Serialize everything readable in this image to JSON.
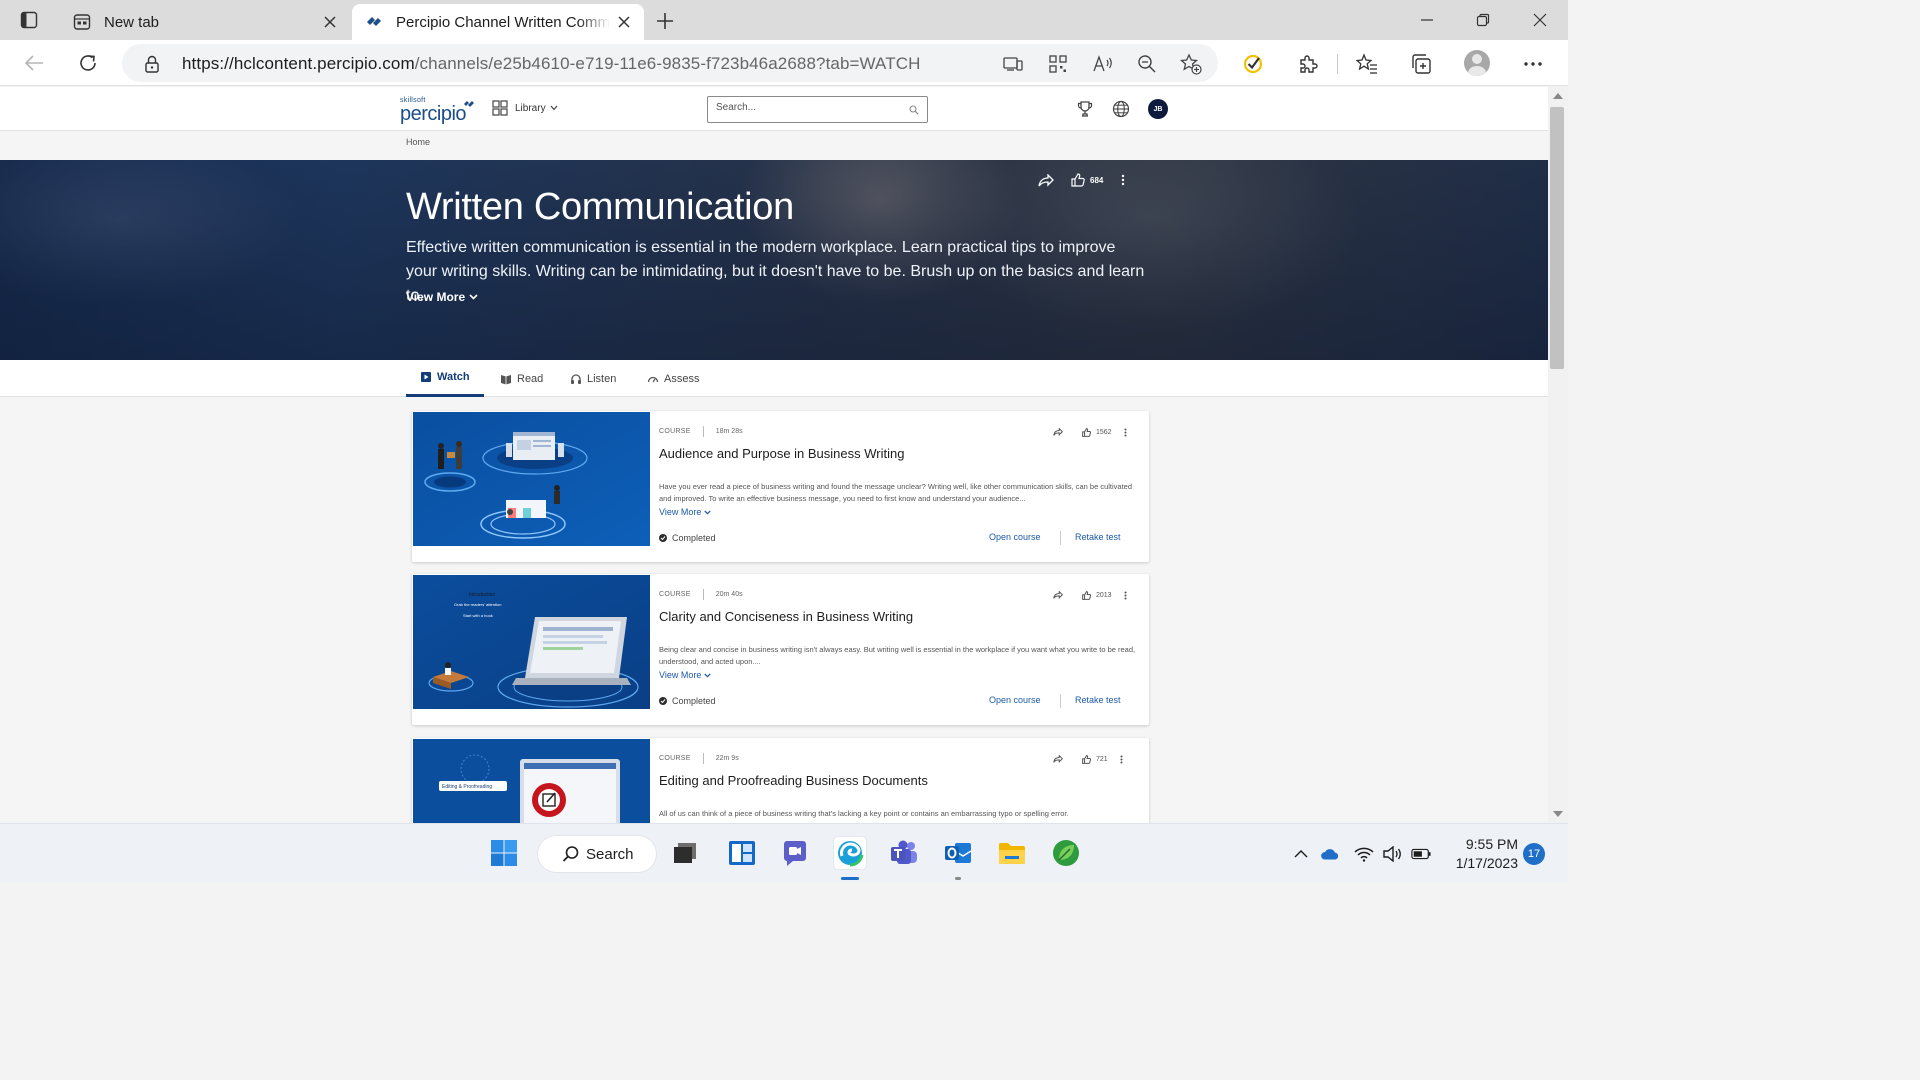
{
  "browser": {
    "tabs": [
      {
        "title": "New tab",
        "active": false
      },
      {
        "title": "Percipio Channel Written Communication",
        "active": true
      }
    ],
    "url_host": "https://hclcontent.percipio.com",
    "url_path": "/channels/e25b4610-e719-11e6-9835-f723b46a2688?tab=WATCH"
  },
  "site": {
    "logo_small": "skillsoft",
    "logo_big": "percipio",
    "library_label": "Library",
    "search_placeholder": "Search...",
    "avatar_initials": "JB",
    "breadcrumb": "Home"
  },
  "hero": {
    "title": "Written Communication",
    "description": "Effective written communication is essential in the modern workplace. Learn practical tips to improve your writing skills. Writing can be intimidating, but it doesn't have to be. Brush up on the basics and learn to...",
    "view_more": "View More",
    "likes": "684"
  },
  "content_tabs": [
    "Watch",
    "Read",
    "Listen",
    "Assess"
  ],
  "cards": [
    {
      "type": "COURSE",
      "duration": "18m 28s",
      "likes": "1562",
      "title": "Audience and Purpose in Business Writing",
      "description": "Have you ever read a piece of business writing and found the message unclear? Writing well, like other communication skills, can be cultivated and improved. To write an effective business message, you need to first know and understand your audience...",
      "view_more": "View More",
      "status": "Completed",
      "open_label": "Open course",
      "retake_label": "Retake test"
    },
    {
      "type": "COURSE",
      "duration": "20m 40s",
      "likes": "2013",
      "title": "Clarity and Conciseness in Business Writing",
      "description": "Being clear and concise in business writing isn't always easy. But writing well is essential in the workplace if you want what you write to be read, understood, and acted upon....",
      "view_more": "View More",
      "status": "Completed",
      "open_label": "Open course",
      "retake_label": "Retake test",
      "thumb_labels": [
        "Introduction",
        "Grab the readers' attention",
        "Start with a hook"
      ]
    },
    {
      "type": "COURSE",
      "duration": "22m 9s",
      "likes": "721",
      "title": "Editing and Proofreading Business Documents",
      "description": "All of us can think of a piece of business writing that's lacking a key point or contains an embarrassing typo or spelling error.",
      "thumb_labels": [
        "Editing & Proofreading"
      ]
    }
  ],
  "taskbar": {
    "search_label": "Search",
    "time": "9:55 PM",
    "date": "1/17/2023",
    "notifications": "17"
  },
  "colors": {
    "brand": "#1c4e8a",
    "link": "#1e5aa8",
    "active_tab": "#123c7a"
  }
}
